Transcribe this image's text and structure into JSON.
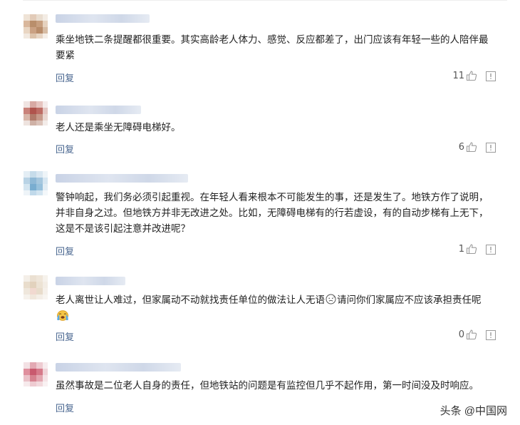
{
  "comments": [
    {
      "text": "乘坐地铁二条提醒都很重要。其实高龄老人体力、感觉、反应都差了，出门应该有年轻一些的人陪伴最要紧",
      "reply": "回复",
      "likes": "11"
    },
    {
      "text": "老人还是乘坐无障碍电梯好。",
      "reply": "回复",
      "likes": "6"
    },
    {
      "text": "警钟响起，我们务必须引起重视。在年轻人看来根本不可能发生的事，还是发生了。地铁方作了说明，并非自身之过。但地铁方并非无改进之处。比如，无障碍电梯有的行若虚设，有的自动步梯有上无下，这是不是该引起注意并改进呢？",
      "reply": "回复",
      "likes": "1"
    },
    {
      "text_a": "老人离世让人难过，但家属动不动就找责任单位的做法让人无语",
      "text_b": "请问你们家属应不应该承担责任呢",
      "reply": "回复",
      "likes": "0"
    },
    {
      "text": "虽然事故是二位老人自身的责任，但地铁站的问题是有监控但几乎不起作用，第一时间没及时响应。",
      "reply": "回复"
    }
  ],
  "icons": [
    "thumbs-up-icon",
    "report-icon",
    "sweat-emoji",
    "crying-emoji"
  ],
  "watermark": "头条 @中国网",
  "colors": {
    "reply": "#4a6790",
    "text": "#222222",
    "count": "#555555"
  }
}
